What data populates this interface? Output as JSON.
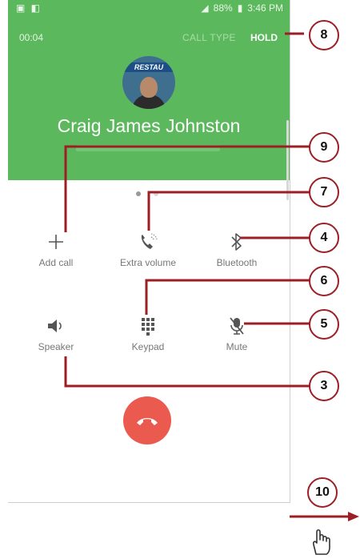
{
  "status_bar": {
    "time": "3:46 PM",
    "battery": "88%"
  },
  "call": {
    "timer": "00:04",
    "call_type_label": "CALL TYPE",
    "hold_label": "HOLD",
    "avatar_sign": "RESTAU",
    "contact_name": "Craig James Johnston"
  },
  "buttons": {
    "add_call": "Add call",
    "extra_volume": "Extra volume",
    "bluetooth": "Bluetooth",
    "speaker": "Speaker",
    "keypad": "Keypad",
    "mute": "Mute"
  },
  "callouts": {
    "c8": "8",
    "c9": "9",
    "c7": "7",
    "c4": "4",
    "c6": "6",
    "c5": "5",
    "c3": "3",
    "c10": "10"
  },
  "colors": {
    "call_green": "#5cb85c",
    "end_red": "#ea5a4f",
    "callout_border": "#9b1f25"
  }
}
